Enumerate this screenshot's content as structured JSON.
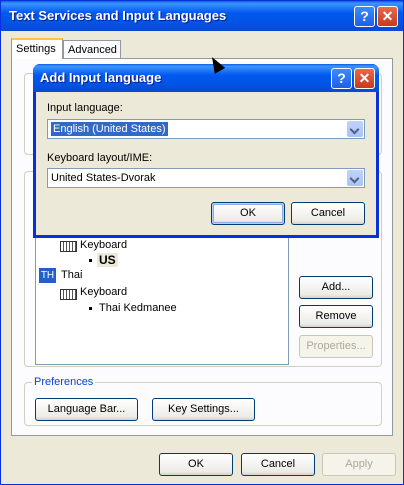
{
  "window": {
    "title": "Text Services and Input Languages"
  },
  "titlebar": {
    "help": "?",
    "close": "✕"
  },
  "tabs": [
    {
      "label": "Settings"
    },
    {
      "label": "Advanced"
    }
  ],
  "installed": {
    "items": [
      {
        "kind": "keyboard",
        "label": "Keyboard"
      },
      {
        "kind": "layout",
        "label": "US"
      },
      {
        "kind": "language",
        "code": "TH",
        "label": "Thai"
      },
      {
        "kind": "keyboard",
        "label": "Keyboard"
      },
      {
        "kind": "layout",
        "label": "Thai Kedmanee"
      }
    ]
  },
  "side_buttons": {
    "add": "Add...",
    "remove": "Remove",
    "properties": "Properties..."
  },
  "preferences": {
    "label": "Preferences",
    "language_bar": "Language Bar...",
    "key_settings": "Key Settings..."
  },
  "footer": {
    "ok": "OK",
    "cancel": "Cancel",
    "apply": "Apply"
  },
  "dialog": {
    "title": "Add Input language",
    "help": "?",
    "close": "✕",
    "input_language_label": "Input language:",
    "input_language_value": "English (United States)",
    "keyboard_label": "Keyboard layout/IME:",
    "keyboard_value": "United States-Dvorak",
    "ok": "OK",
    "cancel": "Cancel"
  }
}
